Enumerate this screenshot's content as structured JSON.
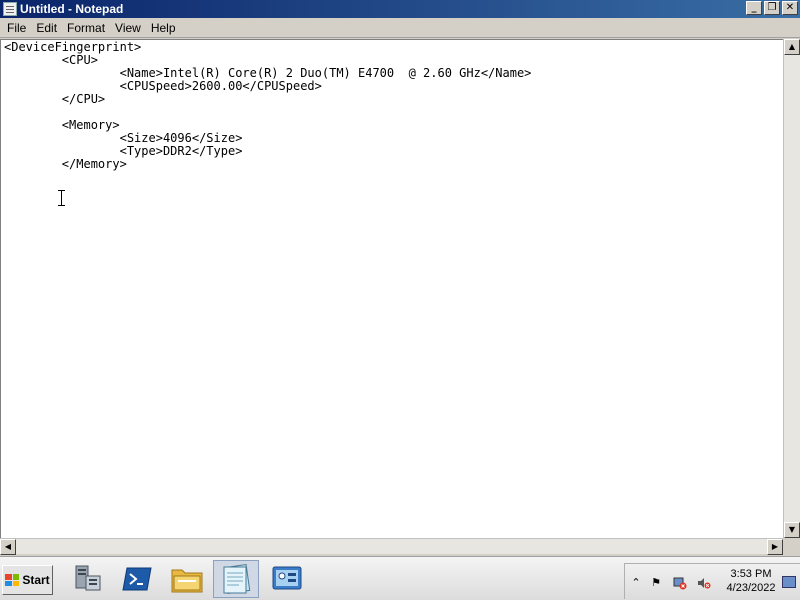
{
  "window": {
    "title": "Untitled - Notepad",
    "minimize_icon": "minimize-icon",
    "restore_icon": "restore-icon",
    "close_icon": "close-icon"
  },
  "menu": {
    "items": [
      "File",
      "Edit",
      "Format",
      "View",
      "Help"
    ]
  },
  "editor": {
    "content": "<DeviceFingerprint>\n\t<CPU>\n\t\t<Name>Intel(R) Core(R) 2 Duo(TM) E4700\t@ 2.60 GHz</Name>\n\t\t<CPUSpeed>2600.00</CPUSpeed>\n\t</CPU>\n\n\t<Memory>\n\t\t<Size>4096</Size>\n\t\t<Type>DDR2</Type>\n\t</Memory>"
  },
  "taskbar": {
    "start_label": "Start",
    "apps": [
      "server-manager-icon",
      "powershell-icon",
      "explorer-folder-icon",
      "notepad-icon",
      "control-panel-icon"
    ],
    "tray_icons": [
      "show-hidden-icons-chevron",
      "action-center-flag-icon",
      "network-disconnected-icon",
      "volume-muted-icon"
    ],
    "clock": {
      "time": "3:53 PM",
      "date": "4/23/2022"
    }
  },
  "colors": {
    "titlebar_start": "#0a246a",
    "titlebar_end": "#3a6ea5",
    "window_bg": "#d4d0c8",
    "editor_bg": "#ffffff"
  }
}
